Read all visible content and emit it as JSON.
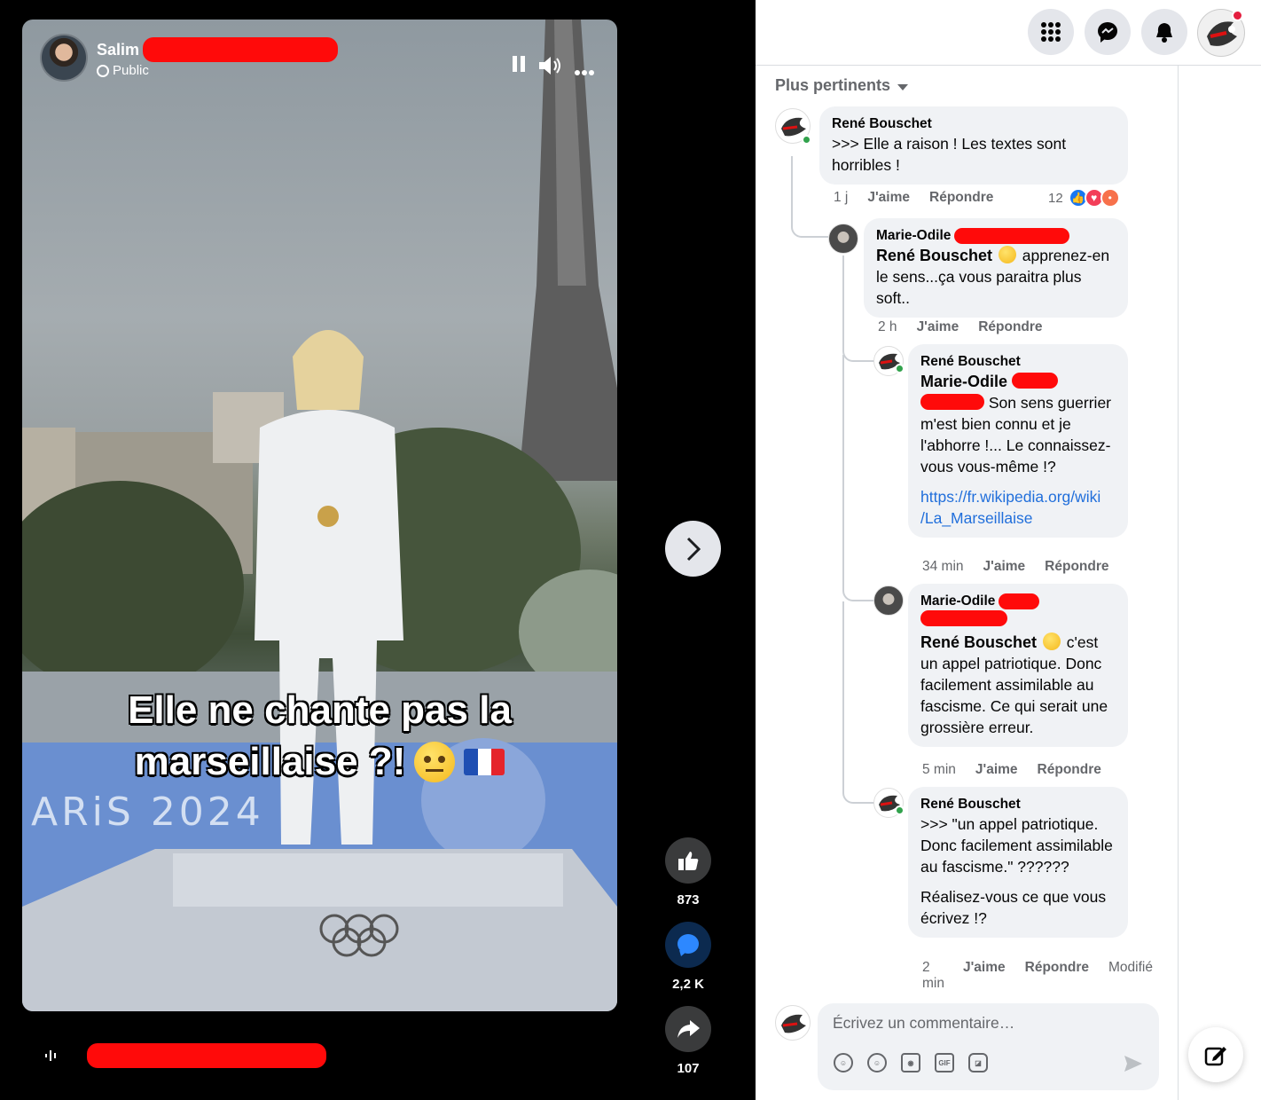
{
  "video": {
    "author_name": "Salim",
    "audience": "Public",
    "caption_line1": "Elle ne chante pas la",
    "caption_line2": "marseillaise ?!",
    "backdrop_text": "ARiS 2024",
    "reactions": {
      "likes": "873",
      "comments": "2,2 K",
      "shares": "107"
    },
    "colors": {
      "redaction": "#ff0a0a"
    }
  },
  "topbar": {
    "icons": [
      "grid-menu-icon",
      "messenger-icon",
      "bell-icon",
      "profile-avatar"
    ]
  },
  "comments_panel": {
    "sort_label": "Plus pertinents",
    "comments": [
      {
        "author": "René Bouschet",
        "text": ">>> Elle a raison ! Les textes sont horribles !",
        "time": "1 j",
        "like": "J'aime",
        "reply": "Répondre",
        "reaction_count": "12"
      },
      {
        "author": "Marie-Odile",
        "mention": "René Bouschet",
        "text": "apprenez-en le sens...ça vous paraitra plus soft..",
        "time": "2 h",
        "like": "J'aime",
        "reply": "Répondre"
      },
      {
        "author": "René Bouschet",
        "mention": "Marie-Odile",
        "text": "Son sens guerrier m'est bien connu et je l'abhorre !... Le connaissez-vous vous-même !?",
        "link_line1": "https://fr.wikipedia.org/wiki",
        "link_line2": "/La_Marseillaise",
        "time": "34 min",
        "like": "J'aime",
        "reply": "Répondre"
      },
      {
        "author": "Marie-Odile",
        "mention": "René Bouschet",
        "text": "c'est un appel patriotique. Donc facilement assimilable au fascisme. Ce qui serait une grossière erreur.",
        "time": "5 min",
        "like": "J'aime",
        "reply": "Répondre"
      },
      {
        "author": "René Bouschet",
        "text": ">>> \"un appel patriotique. Donc facilement assimilable au fascisme.\" ??????",
        "text2": "Réalisez-vous ce que vous écrivez !?",
        "time": "2 min",
        "like": "J'aime",
        "reply": "Répondre",
        "edited": "Modifié"
      }
    ],
    "composer_placeholder": "Écrivez un commentaire…"
  }
}
